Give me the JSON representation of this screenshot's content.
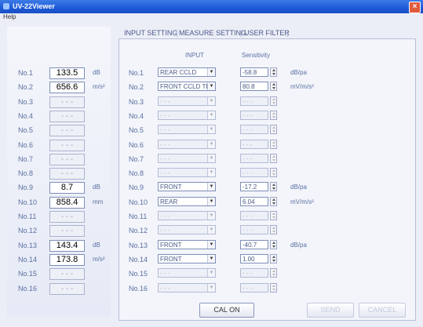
{
  "window": {
    "title": "UV-22Viewer"
  },
  "menu": {
    "help": "Help"
  },
  "tabs": [
    {
      "label": "INPUT SETTING"
    },
    {
      "label": "MEASURE SETTING"
    },
    {
      "label": "USER FILTER"
    }
  ],
  "headers": {
    "input": "INPUT",
    "sensitivity": "Sensitivity"
  },
  "channels": [
    {
      "label": "No.1",
      "value": "133.5",
      "unit": "dB",
      "input": "REAR CCLD",
      "sens": "-58.8",
      "sens_unit": "dB/pa"
    },
    {
      "label": "No.2",
      "value": "656.6",
      "unit": "m/s²",
      "input": "FRONT CCLD TEDS",
      "sens": "80.8",
      "sens_unit": "mV/m/s²"
    },
    {
      "label": "No.3",
      "value": "- - -",
      "unit": "",
      "input": "",
      "sens": "",
      "sens_unit": ""
    },
    {
      "label": "No.4",
      "value": "- - -",
      "unit": "",
      "input": "",
      "sens": "",
      "sens_unit": ""
    },
    {
      "label": "No.5",
      "value": "- - -",
      "unit": "",
      "input": "",
      "sens": "",
      "sens_unit": ""
    },
    {
      "label": "No.6",
      "value": "- - -",
      "unit": "",
      "input": "",
      "sens": "",
      "sens_unit": ""
    },
    {
      "label": "No.7",
      "value": "- - -",
      "unit": "",
      "input": "",
      "sens": "",
      "sens_unit": ""
    },
    {
      "label": "No.8",
      "value": "- - -",
      "unit": "",
      "input": "",
      "sens": "",
      "sens_unit": ""
    },
    {
      "label": "No.9",
      "value": "8.7",
      "unit": "dB",
      "input": "FRONT",
      "sens": "-17.2",
      "sens_unit": "dB/pa"
    },
    {
      "label": "No.10",
      "value": "858.4",
      "unit": "mm",
      "input": "REAR",
      "sens": "6.04",
      "sens_unit": "mV/m/s²"
    },
    {
      "label": "No.11",
      "value": "- - -",
      "unit": "",
      "input": "",
      "sens": "",
      "sens_unit": ""
    },
    {
      "label": "No.12",
      "value": "- - -",
      "unit": "",
      "input": "",
      "sens": "",
      "sens_unit": ""
    },
    {
      "label": "No.13",
      "value": "143.4",
      "unit": "dB",
      "input": "FRONT",
      "sens": "-40.7",
      "sens_unit": "dB/pa"
    },
    {
      "label": "No.14",
      "value": "173.8",
      "unit": "m/s²",
      "input": "FRONT",
      "sens": "1.00",
      "sens_unit": ""
    },
    {
      "label": "No.15",
      "value": "- - -",
      "unit": "",
      "input": "",
      "sens": "",
      "sens_unit": ""
    },
    {
      "label": "No.16",
      "value": "- - -",
      "unit": "",
      "input": "",
      "sens": "",
      "sens_unit": ""
    }
  ],
  "buttons": {
    "cal_on": "CAL ON",
    "send": "SEND",
    "cancel": "CANCEL"
  }
}
